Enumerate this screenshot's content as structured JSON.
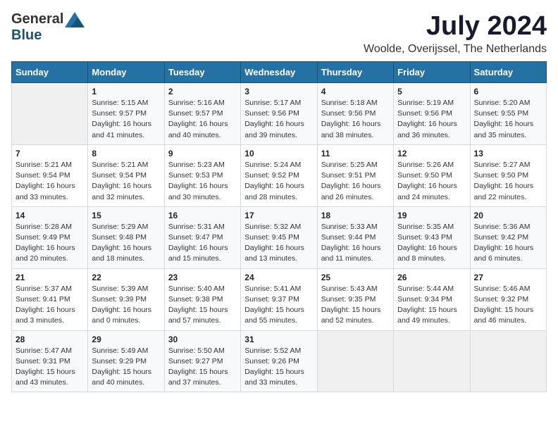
{
  "header": {
    "logo_general": "General",
    "logo_blue": "Blue",
    "title": "July 2024",
    "subtitle": "Woolde, Overijssel, The Netherlands"
  },
  "calendar": {
    "days_header": [
      "Sunday",
      "Monday",
      "Tuesday",
      "Wednesday",
      "Thursday",
      "Friday",
      "Saturday"
    ],
    "weeks": [
      [
        {
          "day": "",
          "info": ""
        },
        {
          "day": "1",
          "info": "Sunrise: 5:15 AM\nSunset: 9:57 PM\nDaylight: 16 hours\nand 41 minutes."
        },
        {
          "day": "2",
          "info": "Sunrise: 5:16 AM\nSunset: 9:57 PM\nDaylight: 16 hours\nand 40 minutes."
        },
        {
          "day": "3",
          "info": "Sunrise: 5:17 AM\nSunset: 9:56 PM\nDaylight: 16 hours\nand 39 minutes."
        },
        {
          "day": "4",
          "info": "Sunrise: 5:18 AM\nSunset: 9:56 PM\nDaylight: 16 hours\nand 38 minutes."
        },
        {
          "day": "5",
          "info": "Sunrise: 5:19 AM\nSunset: 9:56 PM\nDaylight: 16 hours\nand 36 minutes."
        },
        {
          "day": "6",
          "info": "Sunrise: 5:20 AM\nSunset: 9:55 PM\nDaylight: 16 hours\nand 35 minutes."
        }
      ],
      [
        {
          "day": "7",
          "info": "Sunrise: 5:21 AM\nSunset: 9:54 PM\nDaylight: 16 hours\nand 33 minutes."
        },
        {
          "day": "8",
          "info": "Sunrise: 5:21 AM\nSunset: 9:54 PM\nDaylight: 16 hours\nand 32 minutes."
        },
        {
          "day": "9",
          "info": "Sunrise: 5:23 AM\nSunset: 9:53 PM\nDaylight: 16 hours\nand 30 minutes."
        },
        {
          "day": "10",
          "info": "Sunrise: 5:24 AM\nSunset: 9:52 PM\nDaylight: 16 hours\nand 28 minutes."
        },
        {
          "day": "11",
          "info": "Sunrise: 5:25 AM\nSunset: 9:51 PM\nDaylight: 16 hours\nand 26 minutes."
        },
        {
          "day": "12",
          "info": "Sunrise: 5:26 AM\nSunset: 9:50 PM\nDaylight: 16 hours\nand 24 minutes."
        },
        {
          "day": "13",
          "info": "Sunrise: 5:27 AM\nSunset: 9:50 PM\nDaylight: 16 hours\nand 22 minutes."
        }
      ],
      [
        {
          "day": "14",
          "info": "Sunrise: 5:28 AM\nSunset: 9:49 PM\nDaylight: 16 hours\nand 20 minutes."
        },
        {
          "day": "15",
          "info": "Sunrise: 5:29 AM\nSunset: 9:48 PM\nDaylight: 16 hours\nand 18 minutes."
        },
        {
          "day": "16",
          "info": "Sunrise: 5:31 AM\nSunset: 9:47 PM\nDaylight: 16 hours\nand 15 minutes."
        },
        {
          "day": "17",
          "info": "Sunrise: 5:32 AM\nSunset: 9:45 PM\nDaylight: 16 hours\nand 13 minutes."
        },
        {
          "day": "18",
          "info": "Sunrise: 5:33 AM\nSunset: 9:44 PM\nDaylight: 16 hours\nand 11 minutes."
        },
        {
          "day": "19",
          "info": "Sunrise: 5:35 AM\nSunset: 9:43 PM\nDaylight: 16 hours\nand 8 minutes."
        },
        {
          "day": "20",
          "info": "Sunrise: 5:36 AM\nSunset: 9:42 PM\nDaylight: 16 hours\nand 6 minutes."
        }
      ],
      [
        {
          "day": "21",
          "info": "Sunrise: 5:37 AM\nSunset: 9:41 PM\nDaylight: 16 hours\nand 3 minutes."
        },
        {
          "day": "22",
          "info": "Sunrise: 5:39 AM\nSunset: 9:39 PM\nDaylight: 16 hours\nand 0 minutes."
        },
        {
          "day": "23",
          "info": "Sunrise: 5:40 AM\nSunset: 9:38 PM\nDaylight: 15 hours\nand 57 minutes."
        },
        {
          "day": "24",
          "info": "Sunrise: 5:41 AM\nSunset: 9:37 PM\nDaylight: 15 hours\nand 55 minutes."
        },
        {
          "day": "25",
          "info": "Sunrise: 5:43 AM\nSunset: 9:35 PM\nDaylight: 15 hours\nand 52 minutes."
        },
        {
          "day": "26",
          "info": "Sunrise: 5:44 AM\nSunset: 9:34 PM\nDaylight: 15 hours\nand 49 minutes."
        },
        {
          "day": "27",
          "info": "Sunrise: 5:46 AM\nSunset: 9:32 PM\nDaylight: 15 hours\nand 46 minutes."
        }
      ],
      [
        {
          "day": "28",
          "info": "Sunrise: 5:47 AM\nSunset: 9:31 PM\nDaylight: 15 hours\nand 43 minutes."
        },
        {
          "day": "29",
          "info": "Sunrise: 5:49 AM\nSunset: 9:29 PM\nDaylight: 15 hours\nand 40 minutes."
        },
        {
          "day": "30",
          "info": "Sunrise: 5:50 AM\nSunset: 9:27 PM\nDaylight: 15 hours\nand 37 minutes."
        },
        {
          "day": "31",
          "info": "Sunrise: 5:52 AM\nSunset: 9:26 PM\nDaylight: 15 hours\nand 33 minutes."
        },
        {
          "day": "",
          "info": ""
        },
        {
          "day": "",
          "info": ""
        },
        {
          "day": "",
          "info": ""
        }
      ]
    ]
  }
}
